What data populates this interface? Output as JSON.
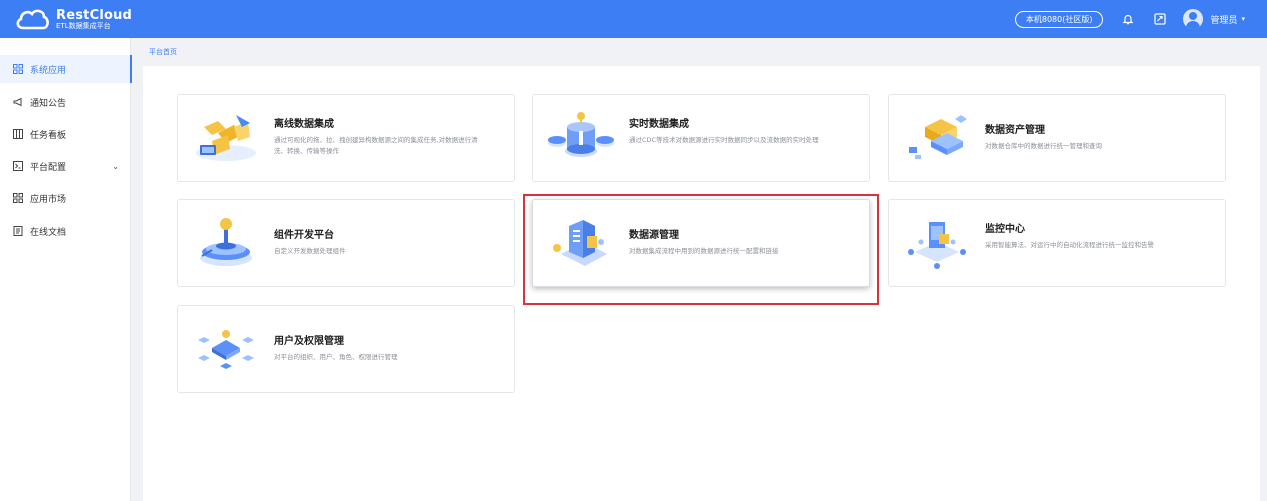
{
  "header": {
    "brand_title": "RestCloud",
    "brand_subtitle": "ETL数据集成平台",
    "version_label": "本机8080(社区版)",
    "user_name": "管理员",
    "user_caret": "▾",
    "bell_icon": "bell-icon",
    "share_icon": "share-icon",
    "accent_color": "#3d7ef5"
  },
  "sidebar": {
    "items": [
      {
        "label": "系统应用",
        "icon": "grid-icon",
        "active": true
      },
      {
        "label": "通知公告",
        "icon": "megaphone-icon"
      },
      {
        "label": "任务看板",
        "icon": "board-icon"
      },
      {
        "label": "平台配置",
        "icon": "config-icon",
        "caret": "⌄"
      },
      {
        "label": "应用市场",
        "icon": "store-icon"
      },
      {
        "label": "在线文档",
        "icon": "doc-icon"
      }
    ]
  },
  "breadcrumb": "平台首页",
  "cards": [
    {
      "title": "离线数据集成",
      "desc": "通过可视化的拖、拉、拽创建异构数据源之间的集成任务,对数据进行清洗、转换、传输等操作",
      "icon": "offline-etl-illustration"
    },
    {
      "title": "实时数据集成",
      "desc": "通过CDC等技术对数据源进行实时数据同步以及流数据的实时处理",
      "icon": "realtime-illustration"
    },
    {
      "title": "数据资产管理",
      "desc": "对数据仓库中的数据进行统一管理和查询",
      "icon": "asset-illustration"
    },
    {
      "title": "组件开发平台",
      "desc": "自定义开发数据处理组件",
      "icon": "component-illustration"
    },
    {
      "title": "数据源管理",
      "desc": "对数据集成流程中用到的数据源进行统一配置和链接",
      "icon": "datasource-illustration",
      "highlight_color": "#d9313d"
    },
    {
      "title": "监控中心",
      "desc": "采用智能算法、对运行中的自动化流程进行统一监控和告警",
      "icon": "monitor-illustration"
    },
    {
      "title": "用户及权限管理",
      "desc": "对平台的组织、用户、角色、权限进行管理",
      "icon": "permission-illustration"
    }
  ]
}
